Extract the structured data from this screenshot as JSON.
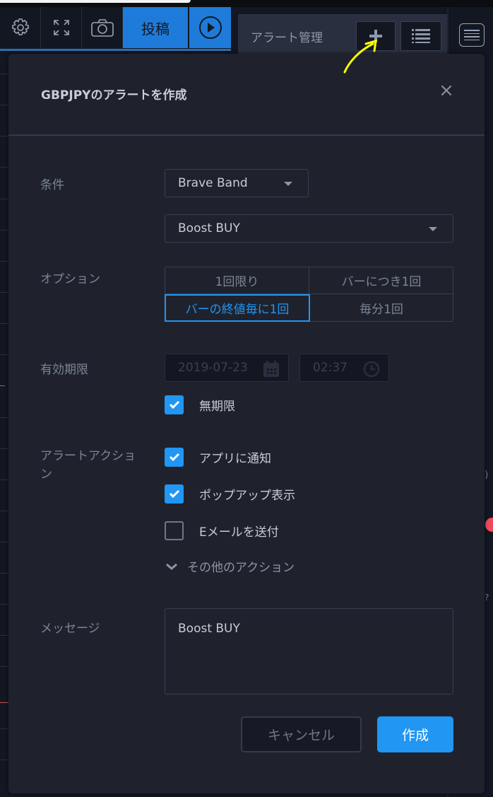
{
  "toolbar": {
    "icons": [
      "gear-icon",
      "fullscreen-icon",
      "camera-icon",
      "play-icon"
    ],
    "publish_label": "投稿",
    "alert_manager_title": "アラート管理",
    "add_alert_icon": "plus-icon",
    "alert_list_icon": "list-icon",
    "menu_icon": "hamburger-menu-icon"
  },
  "annotation": {
    "arrow_color": "#ffff00"
  },
  "dialog": {
    "title": "GBPJPYのアラートを作成",
    "close_label": "×",
    "condition": {
      "label": "条件",
      "indicator": "Brave Band",
      "signal": "Boost BUY"
    },
    "options": {
      "label": "オプション",
      "choices": [
        "1回限り",
        "バーにつき1回",
        "バーの終値毎に1回",
        "毎分1回"
      ],
      "selected": "バーの終値毎に1回"
    },
    "expiration": {
      "label": "有効期限",
      "date": "2019-07-23",
      "time": "02:37",
      "unlimited_label": "無期限",
      "unlimited_checked": true
    },
    "actions": {
      "label": "アラートアクション",
      "items": [
        {
          "label": "アプリに通知",
          "checked": true
        },
        {
          "label": "ポップアップ表示",
          "checked": true
        },
        {
          "label": "Eメールを送付",
          "checked": false
        }
      ],
      "more_label": "その他のアクション"
    },
    "message": {
      "label": "メッセージ",
      "value": "Boost BUY"
    },
    "cancel_label": "キャンセル",
    "create_label": "作成"
  },
  "colors": {
    "accent": "#2196f3",
    "publish_blue": "#1e7bd9",
    "dialog_bg": "#1f222d",
    "edge_marker": "#ef4a5c"
  }
}
